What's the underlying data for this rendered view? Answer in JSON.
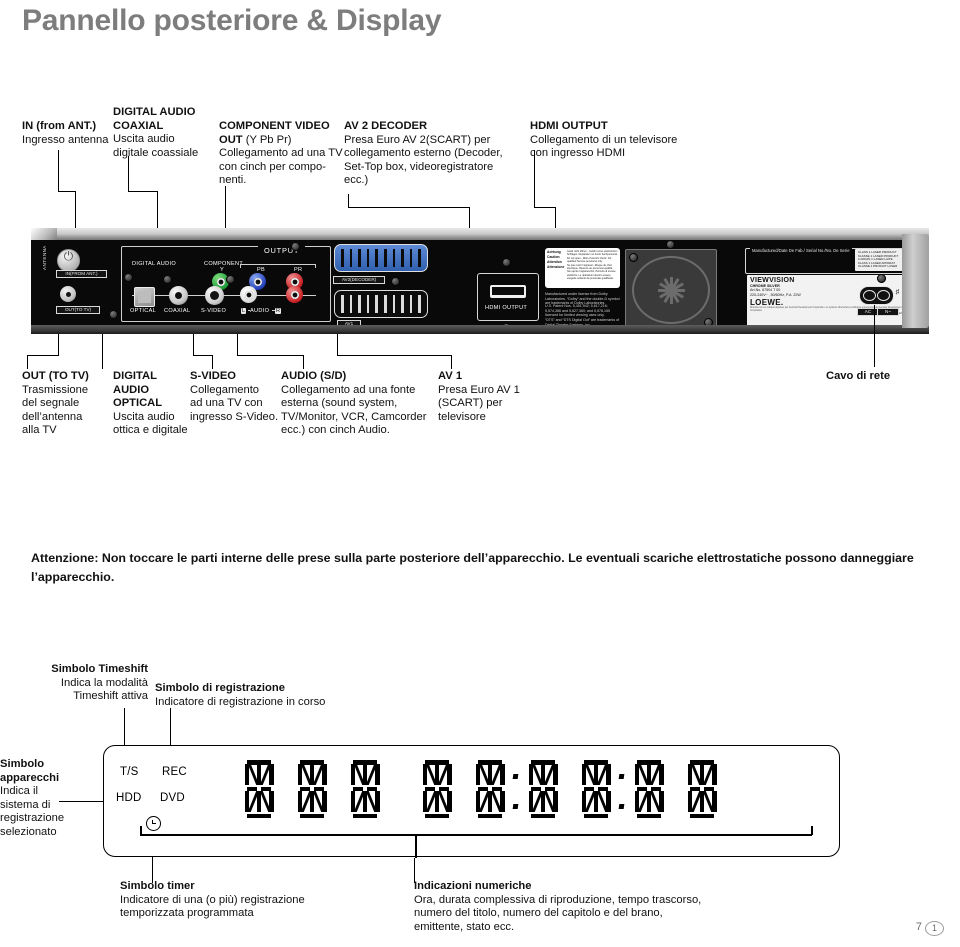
{
  "page": {
    "title": "Pannello posteriore & Display",
    "footer_number": "7",
    "footer_badge": "1"
  },
  "top_annotations": [
    {
      "heading": "IN (from ANT.)",
      "lines": [
        "Ingresso antenna"
      ]
    },
    {
      "heading": "DIGITAL AUDIO",
      "heading2": "COAXIAL",
      "lines": [
        "Uscita audio",
        "digitale coassiale"
      ]
    },
    {
      "heading": "COMPONENT VIDEO",
      "heading2": "OUT",
      "heading2_suffix": " (Y Pb Pr)",
      "lines": [
        "Collegamento ad una TV",
        "con cinch per compo-",
        "nenti."
      ]
    },
    {
      "heading": "AV 2 DECODER",
      "lines": [
        "Presa Euro AV 2(SCART) per",
        "collegamento esterno (Decoder,",
        "Set-Top box, videoregistratore",
        "ecc.)"
      ]
    },
    {
      "heading": "HDMI OUTPUT",
      "lines": [
        "Collegamento di un televisore",
        "con ingresso HDMI"
      ]
    }
  ],
  "bottom_annotations": [
    {
      "heading": "OUT (TO TV)",
      "lines": [
        "Trasmissione",
        "del segnale",
        "dell’antenna",
        "alla TV"
      ]
    },
    {
      "heading": "DIGITAL",
      "heading2": "AUDIO",
      "heading3": "OPTICAL",
      "lines": [
        "Uscita audio",
        "ottica e digitale"
      ]
    },
    {
      "heading": "S-VIDEO",
      "lines": [
        "Collegamento",
        "ad una TV con",
        "ingresso S-Video."
      ]
    },
    {
      "heading": "AUDIO (S/D)",
      "lines": [
        "Collegamento ad una fonte",
        "esterna (sound system,",
        "TV/Monitor, VCR, Camcorder",
        "ecc.) con cinch Audio."
      ]
    },
    {
      "heading": "AV 1",
      "lines": [
        "Presa Euro AV 1",
        "(SCART) per",
        "televisore"
      ]
    },
    {
      "heading": "Cavo di rete",
      "lines": []
    }
  ],
  "rear_panel": {
    "antenna_label": "ANTENNA",
    "in_from_ant": "IN(FROM ANT.)",
    "out_to_tv": "OUT(TO TV)",
    "output_group": "OUTPUT",
    "digital_audio": "DIGITAL AUDIO",
    "component": "COMPONENT",
    "component_y": "Y",
    "component_pb": "PB",
    "component_pr": "PR",
    "optical": "OPTICAL",
    "coaxial": "COAXIAL",
    "svideo": "S-VIDEO",
    "audio_l": "L",
    "audio_label": "AUDIO",
    "audio_r": "R",
    "av2_decoder": "AV2(DECODER)",
    "av1": "AV1",
    "hdmi_output": "HDMI OUTPUT",
    "manufactured": "Manufactured/Date De Fab./ Serial No./No. De Serie",
    "rating_brand": "VIEWVISION",
    "rating_model": "CHROME SILVER",
    "rating_art": "Art.No. 67504 T 00",
    "rating_power": "220-240V~ , 50/60Hz, P.A. 22W",
    "rating_logo": "LOEWE.",
    "rating_legal": "Directive ist une marque déposée par Gemstar Development Corporation. Le système ShowView est fabriqué sous licence de Gemstar Development Corporation.",
    "rating_pn": "P/N MEZ00000000",
    "class_lines": [
      "CLASS 1 LASER PRODUCT",
      "KLASSE 1 LASER PRODUKT",
      "LUOKAN 1 LASER LAITE",
      "KLASS 1 LASER APPARAT",
      "CLASSE 1 PRODUIT LASER"
    ],
    "ac_label": "AC",
    "neutral_label": "N~",
    "caution_rows": [
      {
        "lang": "Achtung",
        "text": "Gerät nicht öffnen - Gefahr eines elektrischen Schlages. Reparatur nur durch Fachpersonal."
      },
      {
        "lang": "Caution",
        "text": "Do not open - Risk of electric shock. For qualified Service personnel only."
      },
      {
        "lang": "Attention",
        "text": "Ne pas ouvrir l’appareil - Risque de choc électrique. Réservé au personnel qualifié."
      },
      {
        "lang": "Attenzione",
        "text": "Non aprire l’apparecchio. Pericolo di scosse elettriche. Le riparazioni devono essere eseguite soltanto da personale qualificato."
      }
    ],
    "dolby_notes": [
      "Manufactured under license from Dolby Laboratories. “Dolby” and the double-D symbol are trademarks of Dolby Laboratories.",
      "U.S. Patent Nos. 5,451,942; 5,617,216; 5,574,386 and 5,627,360; and 5,578,155 licensed for limited viewing uses only.",
      "“DTS” and “DTS Digital Out” are trademarks of Digital Theater Systems, Inc."
    ]
  },
  "warning": {
    "text": "Attenzione: Non toccare le parti interne delle prese sulla parte posteriore dell’apparecchio. Le eventuali scariche elettrostatiche possono danneggiare l’apparecchio."
  },
  "display_annotations": {
    "timeshift": {
      "heading": "Simbolo Timeshift",
      "lines": [
        "Indica la modalità",
        "Timeshift attiva"
      ]
    },
    "registrazione": {
      "heading": "Simbolo di registrazione",
      "lines": [
        "Indicatore di registrazione in corso"
      ]
    },
    "apparecchi": {
      "heading": "Simbolo",
      "heading2": "apparecchi",
      "lines": [
        "Indica il",
        "sistema di",
        "registrazione",
        "selezionato"
      ]
    },
    "timer": {
      "heading": "Simbolo timer",
      "lines": [
        "Indicatore di una (o più) registrazione",
        "temporizzata programmata"
      ]
    },
    "numeriche": {
      "heading": "Indicazioni numeriche",
      "lines": [
        "Ora, durata complessiva di riproduzione, tempo trascorso,",
        "numero del titolo, numero del capitolo e del brano,",
        "emittente, stato ecc."
      ]
    }
  },
  "display_panel": {
    "indicators": [
      "T/S",
      "REC",
      "HDD",
      "DVD"
    ],
    "timer_icon": "clock-icon",
    "segments_count": 9,
    "colons_count": 2,
    "segment_state": "all-on"
  }
}
